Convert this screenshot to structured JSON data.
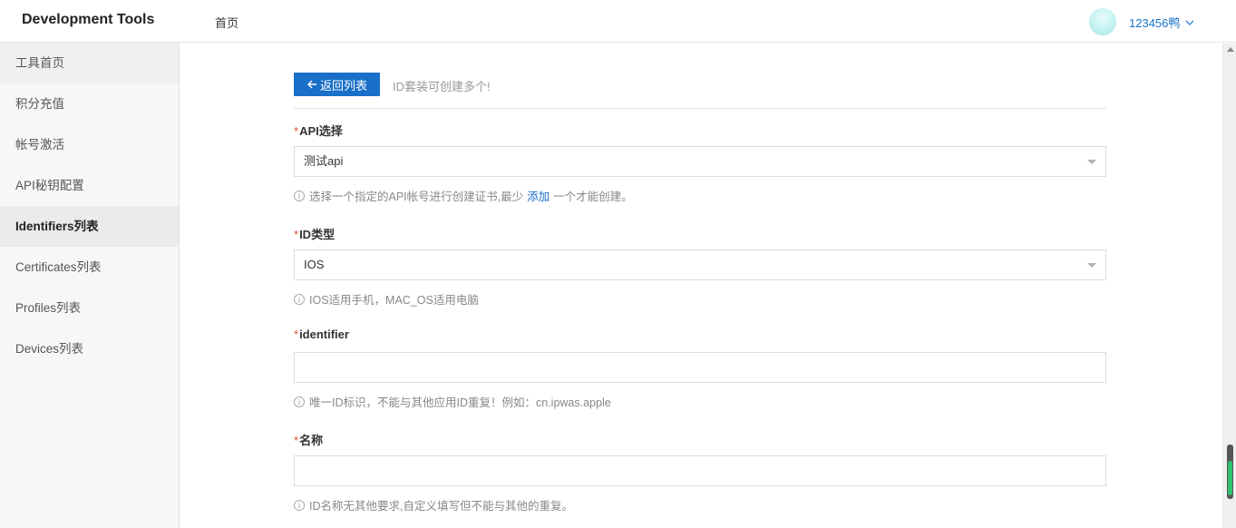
{
  "header": {
    "brand": "Development Tools",
    "nav_home": "首页",
    "user_name": "123456鸭"
  },
  "sidebar": {
    "items": [
      {
        "label": "工具首页"
      },
      {
        "label": "积分充值"
      },
      {
        "label": "帐号激活"
      },
      {
        "label": "API秘钥配置"
      },
      {
        "label": "Identifiers列表",
        "active": true
      },
      {
        "label": "Certificates列表"
      },
      {
        "label": "Profiles列表"
      },
      {
        "label": "Devices列表"
      }
    ]
  },
  "toolbar": {
    "back_label": "返回列表",
    "hint": "ID套装可创建多个!"
  },
  "form": {
    "required_mark": "*",
    "api": {
      "label": "API选择",
      "value": "测试api",
      "help_before": "选择一个指定的API帐号进行创建证书,最少",
      "help_link": "添加",
      "help_after": "一个才能创建。"
    },
    "id_type": {
      "label": "ID类型",
      "value": "IOS",
      "help": "IOS适用手机，MAC_OS适用电脑"
    },
    "identifier": {
      "label": "identifier",
      "value": "",
      "help": "唯一ID标识，不能与其他应用ID重复！例如：cn.ipwas.apple"
    },
    "name": {
      "label": "名称",
      "value": "",
      "help": "ID名称无其他要求,自定义填写但不能与其他的重复。"
    }
  },
  "colors": {
    "primary": "#1a6fc9",
    "required": "#e04d3c",
    "sidebar_bg": "#f7f7f7"
  },
  "icons": {
    "back": "arrow-left-icon",
    "info": "info-circle-icon",
    "dropdown": "caret-down-icon",
    "user_menu": "chevron-down-icon"
  }
}
